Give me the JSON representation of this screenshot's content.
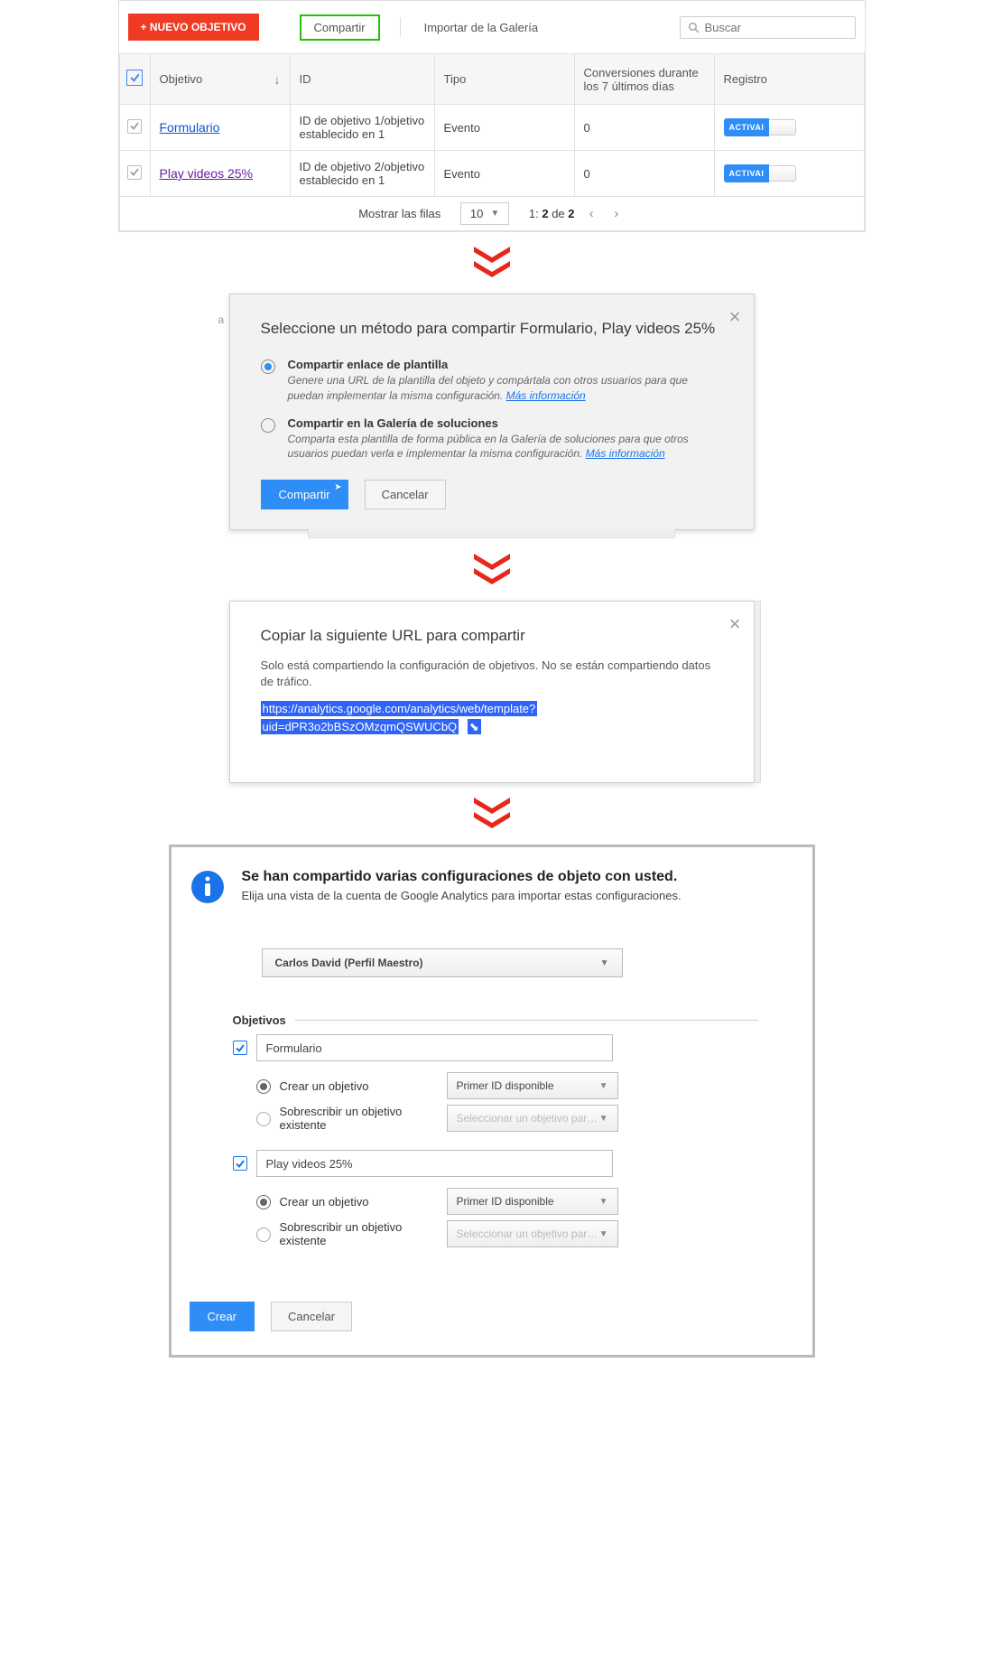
{
  "toolbar": {
    "new_button": "+ NUEVO OBJETIVO",
    "share": "Compartir",
    "import": "Importar de la Galería",
    "search_placeholder": "Buscar"
  },
  "table": {
    "headers": {
      "objetivo": "Objetivo",
      "id": "ID",
      "tipo": "Tipo",
      "conversiones": "Conversiones durante los 7 últimos días",
      "registro": "Registro"
    },
    "rows": [
      {
        "name": "Formulario",
        "link_class": "blue",
        "id": "ID de objetivo 1/objetivo establecido en 1",
        "tipo": "Evento",
        "conv": "0",
        "toggle": "ACTIVAI"
      },
      {
        "name": "Play videos 25%",
        "link_class": "purple",
        "id": "ID de objetivo 2/objetivo establecido en 1",
        "tipo": "Evento",
        "conv": "0",
        "toggle": "ACTIVAI"
      }
    ],
    "pager": {
      "rows_label": "Mostrar las filas",
      "rows_value": "10",
      "range_prefix": "1:",
      "range_current": "2",
      "range_sep": "de",
      "range_total": "2"
    }
  },
  "dialog1": {
    "title": "Seleccione un método para compartir Formulario, Play videos 25%",
    "option1": {
      "title": "Compartir enlace de plantilla",
      "desc": "Genere una URL de la plantilla del objeto y compártala con otros usuarios para que puedan implementar la misma configuración.",
      "more": "Más información"
    },
    "option2": {
      "title": "Compartir en la Galería de soluciones",
      "desc": "Comparta esta plantilla de forma pública en la Galería de soluciones para que otros usuarios puedan verla e implementar la misma configuración.",
      "more": "Más información"
    },
    "share": "Compartir",
    "cancel": "Cancelar"
  },
  "dialog2": {
    "title": "Copiar la siguiente URL para compartir",
    "sub": "Solo está compartiendo la configuración de objetivos. No se están compartiendo datos de tráfico.",
    "url_line1": "https://analytics.google.com/analytics/web/template?",
    "url_line2": "uid=dPR3o2bBSzOMzqmQSWUCbQ"
  },
  "panel3": {
    "title": "Se han compartido varias configuraciones de objeto con usted.",
    "sub": "Elija una vista de la cuenta de Google Analytics para importar estas configuraciones.",
    "account": "Carlos David (Perfil Maestro)",
    "section_label": "Objetivos",
    "objectives": [
      {
        "name": "Formulario",
        "create_label": "Crear un objetivo",
        "overwrite_label": "Sobrescribir un objetivo existente",
        "sel1": "Primer ID disponible",
        "sel2": "Seleccionar un objetivo par…"
      },
      {
        "name": "Play videos 25%",
        "create_label": "Crear un objetivo",
        "overwrite_label": "Sobrescribir un objetivo existente",
        "sel1": "Primer ID disponible",
        "sel2": "Seleccionar un objetivo par…"
      }
    ],
    "create": "Crear",
    "cancel": "Cancelar"
  }
}
